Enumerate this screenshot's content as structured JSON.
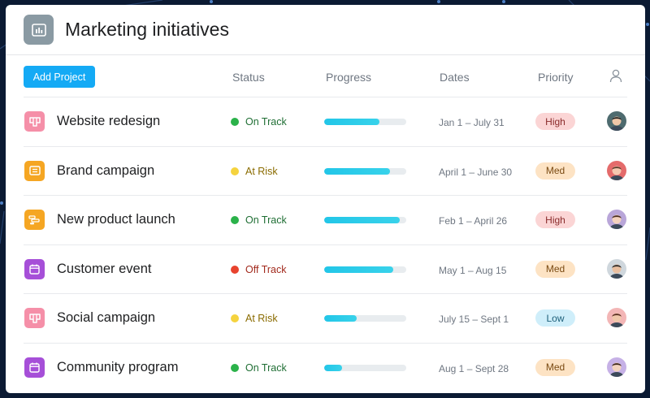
{
  "header": {
    "title": "Marketing initiatives",
    "icon": "bar-chart-icon",
    "icon_color": "#8a9aa3"
  },
  "toolbar": {
    "add_label": "Add Project",
    "columns": {
      "status": "Status",
      "progress": "Progress",
      "dates": "Dates",
      "priority": "Priority",
      "assignee_icon": "person-icon"
    }
  },
  "colors": {
    "accent": "#14aaf5",
    "on_track": "#2bb24a",
    "at_risk": "#f5d33e",
    "off_track": "#e8432e",
    "high_bg": "#fbd5d5",
    "med_bg": "#fde3c4",
    "low_bg": "#cfeefa"
  },
  "projects": [
    {
      "name": "Website redesign",
      "icon": "board-icon",
      "icon_color": "#f58fa8",
      "status": "On Track",
      "status_color": "#2bb24a",
      "status_text_color": "#1f6e34",
      "progress": 0.67,
      "dates": "Jan 1 – July 31",
      "priority": "High",
      "priority_bg": "#fbd5d5",
      "priority_color": "#8a2b2b",
      "avatar_colors": [
        "#4e6b6f",
        "#f0c7a8",
        "#222"
      ]
    },
    {
      "name": "Brand campaign",
      "icon": "list-icon",
      "icon_color": "#f5a623",
      "status": "At Risk",
      "status_color": "#f5d33e",
      "status_text_color": "#8a6b00",
      "progress": 0.8,
      "dates": "April 1 – June 30",
      "priority": "Med",
      "priority_bg": "#fde3c4",
      "priority_color": "#7a4a12",
      "avatar_colors": [
        "#e46b6b",
        "#f5c8b0",
        "#5a3b2a"
      ]
    },
    {
      "name": "New product launch",
      "icon": "timeline-icon",
      "icon_color": "#f5a623",
      "status": "On Track",
      "status_color": "#2bb24a",
      "status_text_color": "#1f6e34",
      "progress": 0.92,
      "dates": "Feb 1 – April 26",
      "priority": "High",
      "priority_bg": "#fbd5d5",
      "priority_color": "#8a2b2b",
      "avatar_colors": [
        "#b9a6d9",
        "#f4d2bd",
        "#4a2e22"
      ]
    },
    {
      "name": "Customer event",
      "icon": "calendar-icon",
      "icon_color": "#a64fd8",
      "status": "Off Track",
      "status_color": "#e8432e",
      "status_text_color": "#a22a1d",
      "progress": 0.84,
      "dates": "May 1 – Aug 15",
      "priority": "Med",
      "priority_bg": "#fde3c4",
      "priority_color": "#7a4a12",
      "avatar_colors": [
        "#cfd7dd",
        "#e9bfa0",
        "#2c2c2c"
      ]
    },
    {
      "name": "Social campaign",
      "icon": "board-icon",
      "icon_color": "#f58fa8",
      "status": "At Risk",
      "status_color": "#f5d33e",
      "status_text_color": "#8a6b00",
      "progress": 0.4,
      "dates": "July 15 – Sept 1",
      "priority": "Low",
      "priority_bg": "#cfeefa",
      "priority_color": "#1d5f7a",
      "avatar_colors": [
        "#f3b6b6",
        "#f0c8aa",
        "#5b2f22"
      ]
    },
    {
      "name": "Community program",
      "icon": "calendar-icon",
      "icon_color": "#a64fd8",
      "status": "On Track",
      "status_color": "#2bb24a",
      "status_text_color": "#1f6e34",
      "progress": 0.22,
      "dates": "Aug 1 – Sept 28",
      "priority": "Med",
      "priority_bg": "#fde3c4",
      "priority_color": "#7a4a12",
      "avatar_colors": [
        "#c6b1e6",
        "#f3d3bd",
        "#3b2519"
      ]
    }
  ]
}
